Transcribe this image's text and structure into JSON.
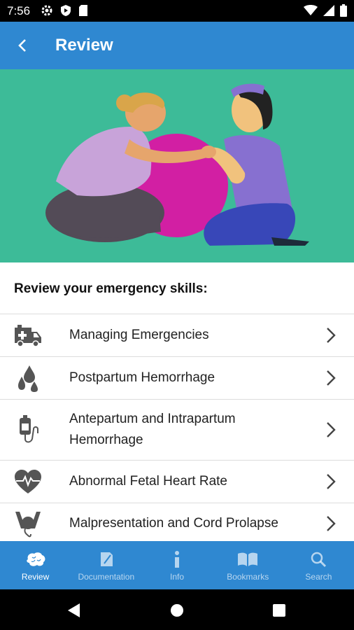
{
  "status_bar": {
    "time": "7:56"
  },
  "app_bar": {
    "title": "Review"
  },
  "section_title": "Review your emergency skills:",
  "items": [
    {
      "label": "Managing Emergencies",
      "icon": "ambulance-icon"
    },
    {
      "label": "Postpartum Hemorrhage",
      "icon": "blood-drops-icon"
    },
    {
      "label": "Antepartum and Intrapartum Hemorrhage",
      "icon": "iv-bag-icon"
    },
    {
      "label": "Abnormal Fetal Heart Rate",
      "icon": "heart-pulse-icon"
    },
    {
      "label": "Malpresentation and Cord Prolapse",
      "icon": "pelvis-icon"
    }
  ],
  "bottom_nav": [
    {
      "label": "Review",
      "icon": "brain-icon",
      "active": true
    },
    {
      "label": "Documentation",
      "icon": "document-icon",
      "active": false
    },
    {
      "label": "Info",
      "icon": "info-icon",
      "active": false
    },
    {
      "label": "Bookmarks",
      "icon": "book-icon",
      "active": false
    },
    {
      "label": "Search",
      "icon": "search-icon",
      "active": false
    }
  ],
  "colors": {
    "primary": "#2f88d1",
    "hero_bg": "#3dbb98",
    "icon_gray": "#555555"
  }
}
